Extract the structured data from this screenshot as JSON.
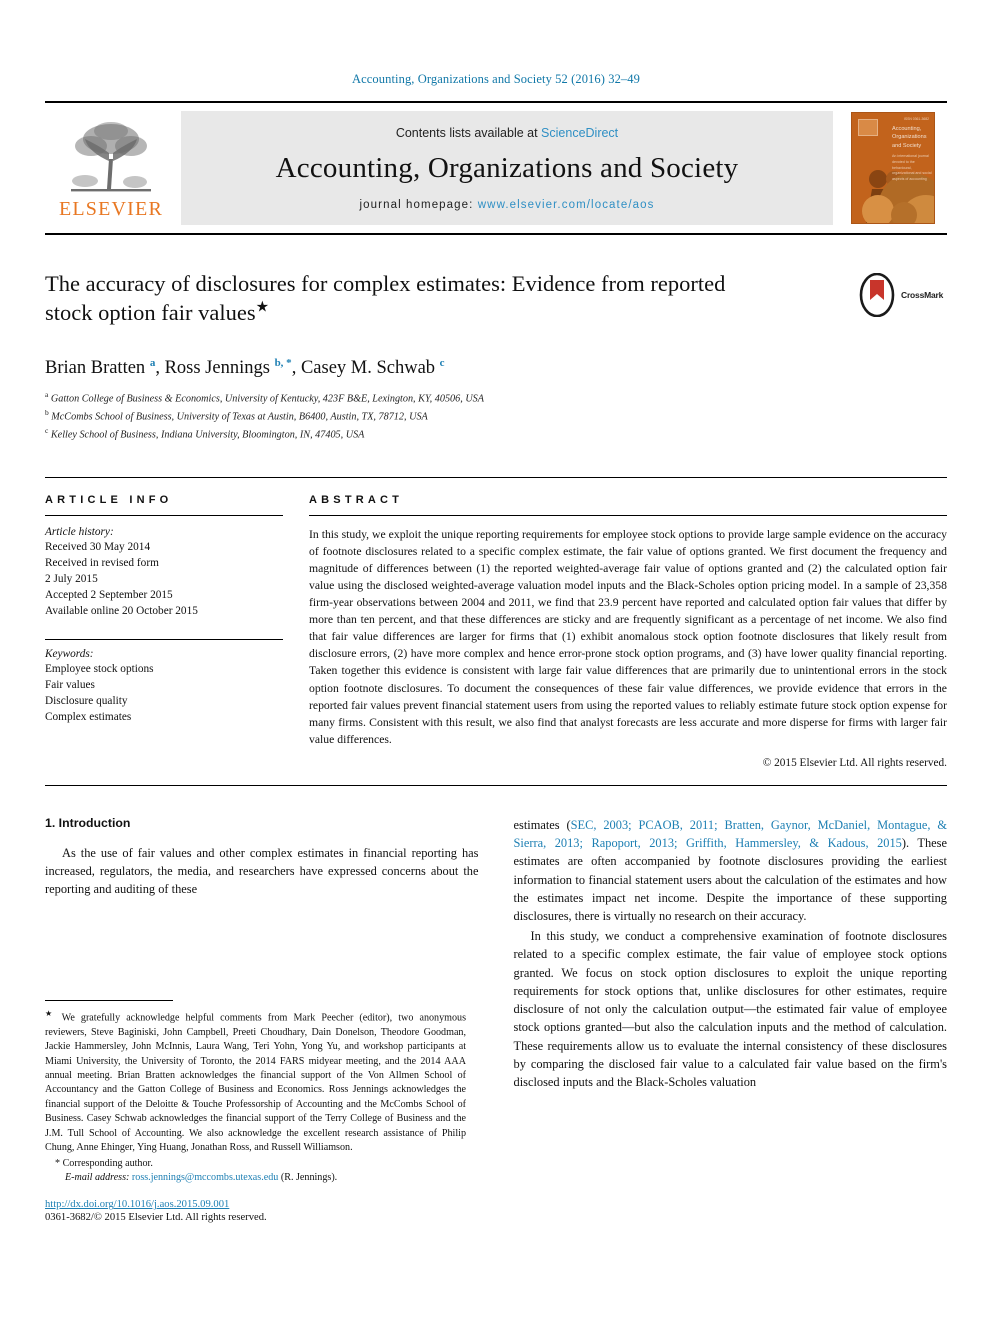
{
  "running_head": "Accounting, Organizations and Society 52 (2016) 32–49",
  "masthead": {
    "publisher_name": "ELSEVIER",
    "contents_prefix": "Contents lists available at ",
    "contents_link": "ScienceDirect",
    "journal_title": "Accounting, Organizations and Society",
    "homepage_prefix": "journal homepage: ",
    "homepage_url": "www.elsevier.com/locate/aos",
    "cover": {
      "title": "Accounting, Organizations and Society",
      "subtitle": "An international journal devoted to the behavioural, organizational and social aspects of accounting",
      "corner_text": "ISSN 0361-3682"
    }
  },
  "article": {
    "title": "The accuracy of disclosures for complex estimates: Evidence from reported stock option fair values",
    "title_marker": "★",
    "crossmark_label": "CrossMark",
    "authors_html": "Brian Bratten <sup>a</sup>, Ross Jennings <sup>b, *</sup>, Casey M. Schwab <sup>c</sup>",
    "affiliations": [
      {
        "marker": "a",
        "text": "Gatton College of Business & Economics, University of Kentucky, 423F B&E, Lexington, KY, 40506, USA"
      },
      {
        "marker": "b",
        "text": "McCombs School of Business, University of Texas at Austin, B6400, Austin, TX, 78712, USA"
      },
      {
        "marker": "c",
        "text": "Kelley School of Business, Indiana University, Bloomington, IN, 47405, USA"
      }
    ]
  },
  "article_info": {
    "heading": "ARTICLE INFO",
    "history_label": "Article history:",
    "history_lines": [
      "Received 30 May 2014",
      "Received in revised form",
      "2 July 2015",
      "Accepted 2 September 2015",
      "Available online 20 October 2015"
    ],
    "keywords_label": "Keywords:",
    "keywords": [
      "Employee stock options",
      "Fair values",
      "Disclosure quality",
      "Complex estimates"
    ]
  },
  "abstract": {
    "heading": "ABSTRACT",
    "text": "In this study, we exploit the unique reporting requirements for employee stock options to provide large sample evidence on the accuracy of footnote disclosures related to a specific complex estimate, the fair value of options granted. We first document the frequency and magnitude of differences between (1) the reported weighted-average fair value of options granted and (2) the calculated option fair value using the disclosed weighted-average valuation model inputs and the Black-Scholes option pricing model. In a sample of 23,358 firm-year observations between 2004 and 2011, we find that 23.9 percent have reported and calculated option fair values that differ by more than ten percent, and that these differences are sticky and are frequently significant as a percentage of net income. We also find that fair value differences are larger for firms that (1) exhibit anomalous stock option footnote disclosures that likely result from disclosure errors, (2) have more complex and hence error-prone stock option programs, and (3) have lower quality financial reporting. Taken together this evidence is consistent with large fair value differences that are primarily due to unintentional errors in the stock option footnote disclosures. To document the consequences of these fair value differences, we provide evidence that errors in the reported fair values prevent financial statement users from using the reported values to reliably estimate future stock option expense for many firms. Consistent with this result, we also find that analyst forecasts are less accurate and more disperse for firms with larger fair value differences.",
    "copyright": "© 2015 Elsevier Ltd. All rights reserved."
  },
  "body": {
    "section_heading": "1. Introduction",
    "left_para_1": "As the use of fair values and other complex estimates in financial reporting has increased, regulators, the media, and researchers have expressed concerns about the reporting and auditing of these",
    "right_para_1_lead": "estimates (",
    "right_para_1_cites": "SEC, 2003; PCAOB, 2011; Bratten, Gaynor, McDaniel, Montague, & Sierra, 2013; Rapoport, 2013; Griffith, Hammersley, & Kadous, 2015",
    "right_para_1_tail": "). These estimates are often accompanied by footnote disclosures providing the earliest information to financial statement users about the calculation of the estimates and how the estimates impact net income. Despite the importance of these supporting disclosures, there is virtually no research on their accuracy.",
    "right_para_2": "In this study, we conduct a comprehensive examination of footnote disclosures related to a specific complex estimate, the fair value of employee stock options granted. We focus on stock option disclosures to exploit the unique reporting requirements for stock options that, unlike disclosures for other estimates, require disclosure of not only the calculation output—the estimated fair value of employee stock options granted—but also the calculation inputs and the method of calculation. These requirements allow us to evaluate the internal consistency of these disclosures by comparing the disclosed fair value to a calculated fair value based on the firm's disclosed inputs and the Black-Scholes valuation"
  },
  "footnotes": {
    "acknowledgement_marker": "★",
    "acknowledgement": "We gratefully acknowledge helpful comments from Mark Peecher (editor), two anonymous reviewers, Steve Baginiski, John Campbell, Preeti Choudhary, Dain Donelson, Theodore Goodman, Jackie Hammersley, John McInnis, Laura Wang, Teri Yohn, Yong Yu, and workshop participants at Miami University, the University of Toronto, the 2014 FARS midyear meeting, and the 2014 AAA annual meeting. Brian Bratten acknowledges the financial support of the Von Allmen School of Accountancy and the Gatton College of Business and Economics. Ross Jennings acknowledges the financial support of the Deloitte & Touche Professorship of Accounting and the McCombs School of Business. Casey Schwab acknowledges the financial support of the Terry College of Business and the J.M. Tull School of Accounting. We also acknowledge the excellent research assistance of Philip Chung, Anne Ehinger, Ying Huang, Jonathan Ross, and Russell Williamson.",
    "corresponding_marker": "*",
    "corresponding_author": "Corresponding author.",
    "email_label": "E-mail address:",
    "email_value": "ross.jennings@mccombs.utexas.edu",
    "email_owner": "(R. Jennings).",
    "doi": "http://dx.doi.org/10.1016/j.aos.2015.09.001",
    "issn_line": "0361-3682/© 2015 Elsevier Ltd. All rights reserved."
  },
  "colors": {
    "link_blue": "#1d7fb3",
    "elsevier_orange": "#e87722",
    "masthead_gray": "#e8e8e8",
    "cover_orange": "#c2631c"
  }
}
